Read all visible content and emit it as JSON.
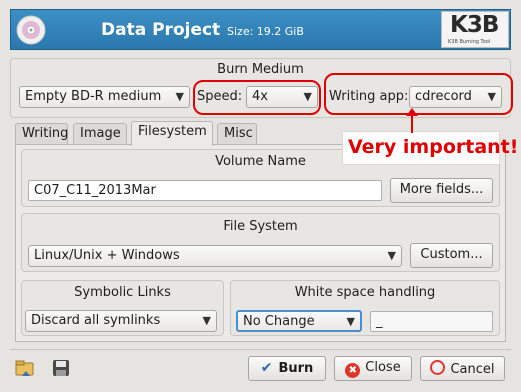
{
  "header": {
    "title": "Data Project",
    "size": "Size: 19.2 GiB",
    "logo_text": "K3B",
    "logo_tagline": "K3B Burning Tool"
  },
  "burn_medium": {
    "group_title": "Burn Medium",
    "medium_value": "Empty BD-R medium",
    "speed_label": "Speed:",
    "speed_value": "4x",
    "writing_app_label": "Writing app:",
    "writing_app_value": "cdrecord"
  },
  "annotation": {
    "text": "Very important!"
  },
  "tabs": [
    {
      "label": "Writing"
    },
    {
      "label": "Image"
    },
    {
      "label": "Filesystem"
    },
    {
      "label": "Misc"
    }
  ],
  "volume": {
    "group_title": "Volume Name",
    "value": "C07_C11_2013Mar",
    "more_fields_label": "More fields..."
  },
  "filesystem": {
    "group_title": "File System",
    "value": "Linux/Unix + Windows",
    "custom_label": "Custom..."
  },
  "symlinks": {
    "group_title": "Symbolic Links",
    "value": "Discard all symlinks"
  },
  "whitespace": {
    "group_title": "White space handling",
    "value": "No Change",
    "replace_value": "_"
  },
  "footer": {
    "burn_label": "Burn",
    "close_label": "Close",
    "cancel_label": "Cancel"
  },
  "icons": {
    "header": "disc-icon",
    "load": "load-settings-icon",
    "save": "save-icon",
    "burn": "checkmark-icon",
    "close": "close-icon",
    "cancel": "cancel-icon"
  },
  "colors": {
    "header_bg": "#3384ba",
    "annotation_red": "#e00000",
    "window_bg": "#e6e4e1"
  }
}
